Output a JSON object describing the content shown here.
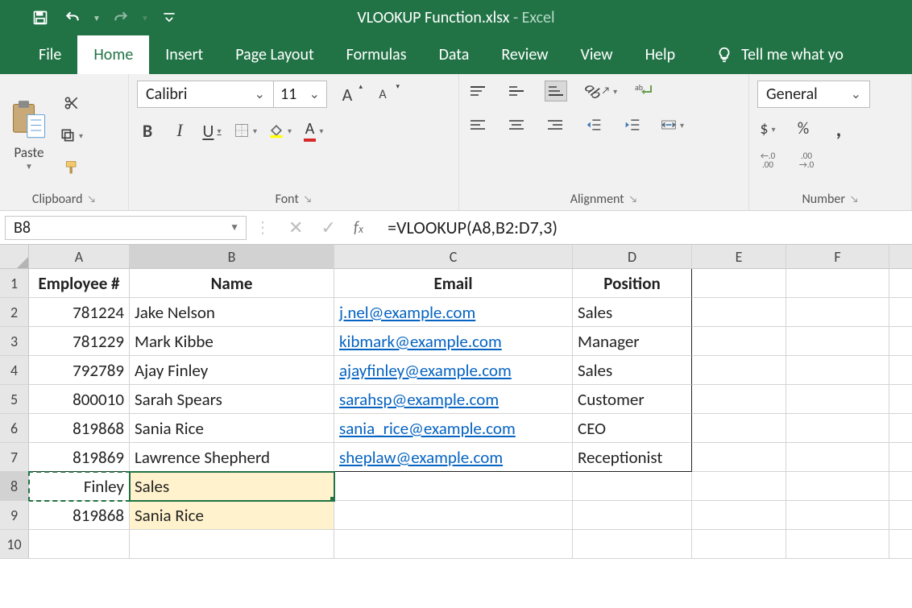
{
  "app": {
    "title": "VLOOKUP Function.xlsx",
    "title_suffix": "  -  Excel"
  },
  "tabs": {
    "file": "File",
    "home": "Home",
    "insert": "Insert",
    "page_layout": "Page Layout",
    "formulas": "Formulas",
    "data": "Data",
    "review": "Review",
    "view": "View",
    "help": "Help",
    "tellme": "Tell me what yo"
  },
  "ribbon": {
    "clipboard": {
      "paste": "Paste",
      "label": "Clipboard"
    },
    "font": {
      "name": "Calibri",
      "size": "11",
      "label": "Font",
      "bold": "B",
      "italic": "I",
      "underline": "U",
      "grow": "A",
      "shrink": "A"
    },
    "alignment": {
      "label": "Alignment"
    },
    "number": {
      "format": "General",
      "label": "Number",
      "dollar": "$",
      "percent": "%",
      "comma": ",",
      "inc": ".00",
      "dec": ".00",
      "inc_sub": "→.0",
      "dec_sub": "←.0"
    }
  },
  "formula_bar": {
    "namebox": "B8",
    "formula": "=VLOOKUP(A8,B2:D7,3)"
  },
  "columns": [
    "A",
    "B",
    "C",
    "D",
    "E",
    "F"
  ],
  "rows": [
    "1",
    "2",
    "3",
    "4",
    "5",
    "6",
    "7",
    "8",
    "9",
    "10"
  ],
  "headers": {
    "A": "Employee #",
    "B": "Name",
    "C": "Email",
    "D": "Position"
  },
  "chart_data": {
    "type": "table",
    "columns": [
      "Employee #",
      "Name",
      "Email",
      "Position"
    ],
    "rows": [
      {
        "Employee #": 781224,
        "Name": "Jake Nelson",
        "Email": "j.nel@example.com",
        "Position": "Sales"
      },
      {
        "Employee #": 781229,
        "Name": "Mark Kibbe",
        "Email": "kibmark@example.com",
        "Position": "Manager"
      },
      {
        "Employee #": 792789,
        "Name": "Ajay Finley",
        "Email": "ajayfinley@example.com",
        "Position": "Sales"
      },
      {
        "Employee #": 800010,
        "Name": "Sarah Spears",
        "Email": "sarahsp@example.com",
        "Position": "Customer"
      },
      {
        "Employee #": 819868,
        "Name": "Sania Rice",
        "Email": "sania_rice@example.com",
        "Position": "CEO"
      },
      {
        "Employee #": 819869,
        "Name": "Lawrence Shepherd",
        "Email": "sheplaw@example.com",
        "Position": "Receptionist"
      }
    ],
    "lookups": [
      {
        "A": "Finley",
        "B": "Sales"
      },
      {
        "A": 819868,
        "B": "Sania Rice"
      }
    ]
  },
  "cells": {
    "r2": {
      "A": "781224",
      "B": "Jake Nelson",
      "C": "j.nel@example.com",
      "D": "Sales"
    },
    "r3": {
      "A": "781229",
      "B": "Mark Kibbe",
      "C": "kibmark@example.com",
      "D": "Manager"
    },
    "r4": {
      "A": "792789",
      "B": "Ajay Finley",
      "C": "ajayfinley@example.com",
      "D": "Sales"
    },
    "r5": {
      "A": "800010",
      "B": "Sarah Spears",
      "C": "sarahsp@example.com",
      "D": "Customer"
    },
    "r6": {
      "A": "819868",
      "B": "Sania Rice",
      "C": "sania_rice@example.com",
      "D": "CEO"
    },
    "r7": {
      "A": "819869",
      "B": "Lawrence Shepherd",
      "C": "sheplaw@example.com",
      "D": "Receptionist"
    },
    "r8": {
      "A": "Finley",
      "B": "Sales"
    },
    "r9": {
      "A": "819868",
      "B": "Sania Rice"
    }
  }
}
